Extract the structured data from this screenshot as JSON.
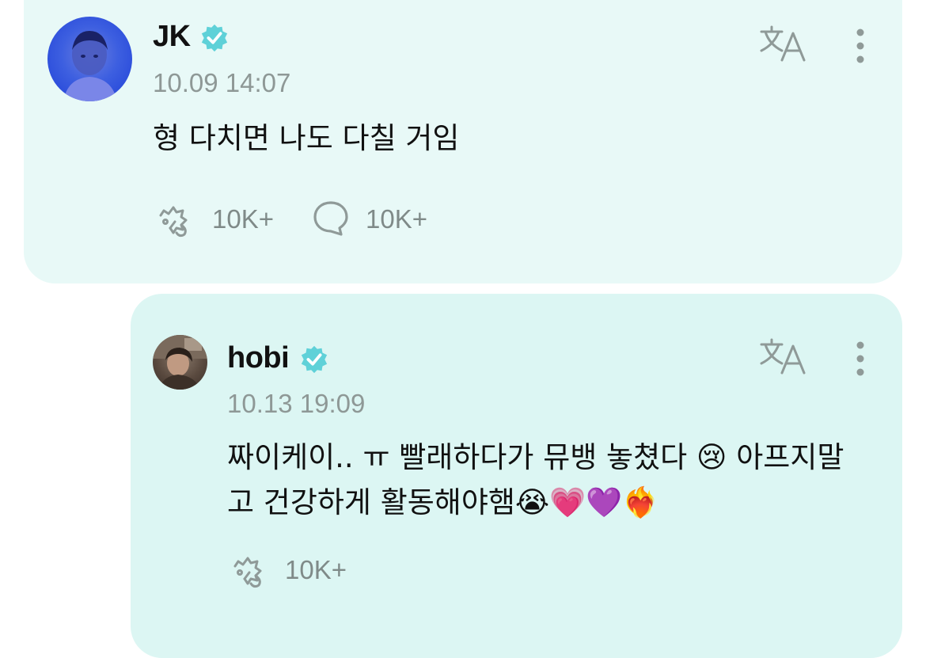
{
  "posts": [
    {
      "author": "JK",
      "verified": true,
      "time": "10.09 14:07",
      "text": "형 다치면 나도 다칠 거임",
      "reactions": "10K+",
      "comments": "10K+"
    },
    {
      "author": "hobi",
      "verified": true,
      "time": "10.13 19:09",
      "text": "짜이케이.. ㅠ 빨래하다가 뮤뱅 놓쳤다 😢 아프지말고 건강하게 활동해야햄😭💗💜❤️‍🔥",
      "reactions": "10K+"
    }
  ],
  "icons": {
    "verified": "verified-check-icon",
    "translate": "translate-icon",
    "more": "more-vertical-icon",
    "reaction": "reaction-hand-icon",
    "comment": "comment-bubble-icon"
  },
  "colors": {
    "card_main_bg": "#e8f9f7",
    "card_reply_bg": "#dcf6f3",
    "verified_badge": "#5fd1d8",
    "icon_gray": "#8f9a98"
  }
}
